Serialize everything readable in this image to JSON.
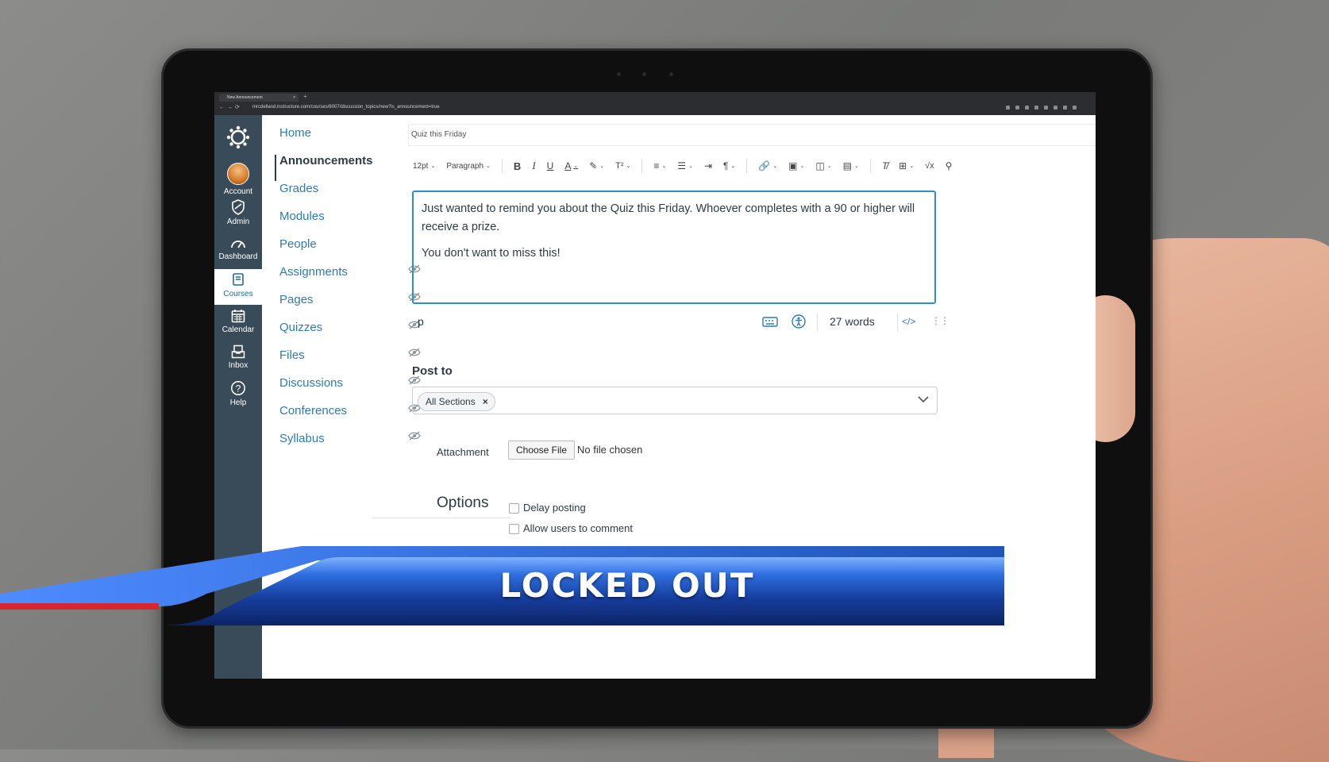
{
  "browser": {
    "tab_title": "New Announcement",
    "tab_close": "×",
    "new_tab": "+",
    "url": "mrcdelland.instructure.com/courses/6007/discussion_topics/new?is_announcement=true"
  },
  "global_nav": {
    "items": [
      {
        "label": "Account",
        "icon": "avatar"
      },
      {
        "label": "Admin",
        "icon": "shield-icon"
      },
      {
        "label": "Dashboard",
        "icon": "speedometer-icon"
      },
      {
        "label": "Courses",
        "icon": "book-icon",
        "active": true
      },
      {
        "label": "Calendar",
        "icon": "calendar-icon"
      },
      {
        "label": "Inbox",
        "icon": "inbox-icon"
      },
      {
        "label": "Help",
        "icon": "help-icon"
      }
    ]
  },
  "course_nav": {
    "items": [
      {
        "label": "Home",
        "hidden_eye": false
      },
      {
        "label": "Announcements",
        "hidden_eye": false,
        "current": true
      },
      {
        "label": "Grades",
        "hidden_eye": false
      },
      {
        "label": "Modules",
        "hidden_eye": false
      },
      {
        "label": "People",
        "hidden_eye": false
      },
      {
        "label": "Assignments",
        "hidden_eye": true
      },
      {
        "label": "Pages",
        "hidden_eye": true
      },
      {
        "label": "Quizzes",
        "hidden_eye": true
      },
      {
        "label": "Files",
        "hidden_eye": true
      },
      {
        "label": "Discussions",
        "hidden_eye": true
      },
      {
        "label": "Conferences",
        "hidden_eye": true
      },
      {
        "label": "Syllabus",
        "hidden_eye": true
      }
    ]
  },
  "announcement": {
    "title": "Quiz this Friday",
    "toolbar": {
      "font_size": "12pt",
      "block_format": "Paragraph"
    },
    "body": [
      "Just wanted to remind you about the Quiz this Friday. Whoever completes with a 90 or higher will receive a prize.",
      "You don't want to miss this!"
    ],
    "status_tag": "p",
    "word_count": "27 words",
    "html_toggle": "</>"
  },
  "post_to": {
    "label": "Post to",
    "chip": "All Sections",
    "chip_remove": "×"
  },
  "attachment": {
    "label": "Attachment",
    "button": "Choose File",
    "status": "No file chosen"
  },
  "options": {
    "label": "Options",
    "checkboxes": [
      {
        "label": "Delay posting",
        "checked": false
      },
      {
        "label": "Allow users to comment",
        "checked": false
      }
    ]
  },
  "banner": {
    "text": "LOCKED OUT",
    "colors": {
      "blue": "#1f54b8",
      "red": "#d8262e"
    }
  },
  "colors": {
    "canvas_nav": "#394b58",
    "link": "#2d7bb5",
    "editor_focus": "#2d8fc9"
  }
}
